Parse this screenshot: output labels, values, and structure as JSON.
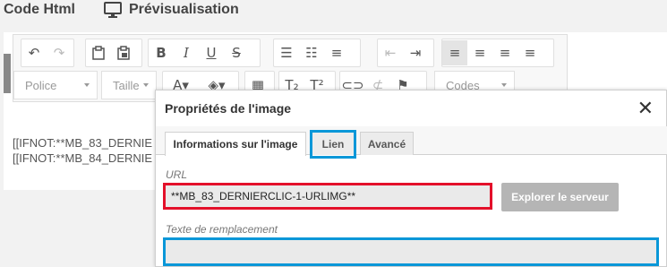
{
  "top_tabs": {
    "code": "Code Html",
    "preview": "Prévisualisation"
  },
  "toolbar": {
    "font_combo": "Police",
    "size_combo": "Taille",
    "codes_combo": "Codes"
  },
  "editor": {
    "line1": "[[IFNOT:**MB_83_DERNIE",
    "line2": "[[IFNOT:**MB_84_DERNIE"
  },
  "dialog": {
    "title": "Propriétés de l'image",
    "tabs": [
      {
        "label": "Informations sur l'image",
        "active": true
      },
      {
        "label": "Lien",
        "active": false
      },
      {
        "label": "Avancé",
        "active": false
      }
    ],
    "url_label": "URL",
    "url_value": "**MB_83_DERNIERCLIC-1-URLIMG**",
    "browse_button": "Explorer le serveur",
    "alt_label": "Texte de remplacement",
    "alt_value": ""
  },
  "colors": {
    "highlight_red": "#e3102a",
    "highlight_blue": "#0a97d8",
    "button_gray": "#b5b5b5"
  }
}
